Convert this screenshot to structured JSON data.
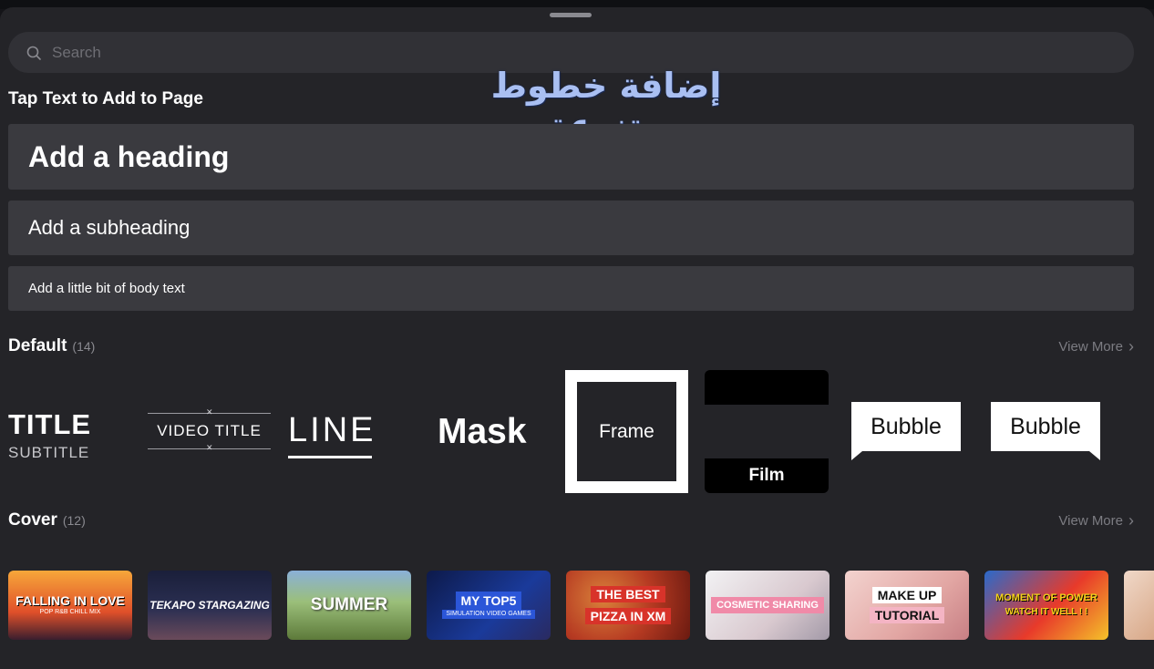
{
  "search": {
    "placeholder": "Search"
  },
  "overlay_text": "إضافة خطوط متنوعة",
  "tap_section": {
    "title": "Tap Text to Add to Page",
    "heading": "Add a heading",
    "subheading": "Add a subheading",
    "body": "Add a little bit of body text"
  },
  "default_section": {
    "title": "Default",
    "count": "(14)",
    "view_more": "View More",
    "presets": {
      "title_main": "TITLE",
      "title_sub": "SUBTITLE",
      "video_title": "VIDEO TITLE",
      "line": "LINE",
      "mask": "Mask",
      "frame": "Frame",
      "film": "Film",
      "bubble_1": "Bubble",
      "bubble_2": "Bubble"
    }
  },
  "cover_section": {
    "title": "Cover",
    "count": "(12)",
    "view_more": "View More",
    "items": [
      {
        "text": "FALLING IN LOVE",
        "sub": "POP R&B CHILL MIX"
      },
      {
        "text": "TEKAPO STARGAZING",
        "sub": ""
      },
      {
        "text": "SUMMER",
        "sub": ""
      },
      {
        "text": "MY TOP5",
        "sub": "SIMULATION VIDEO GAMES"
      },
      {
        "text": "THE BEST",
        "sub": "PIZZA IN XM"
      },
      {
        "text": "COSMETIC SHARING",
        "sub": ""
      },
      {
        "text": "MAKE UP",
        "sub": "TUTORIAL"
      },
      {
        "text": "MOMENT OF POWER",
        "sub": "WATCH IT WELL ! !"
      }
    ]
  },
  "colors": {
    "panel": "#242428",
    "button": "#3a3a3f",
    "overlay": "#a9bff2",
    "muted": "#7c7c82"
  }
}
